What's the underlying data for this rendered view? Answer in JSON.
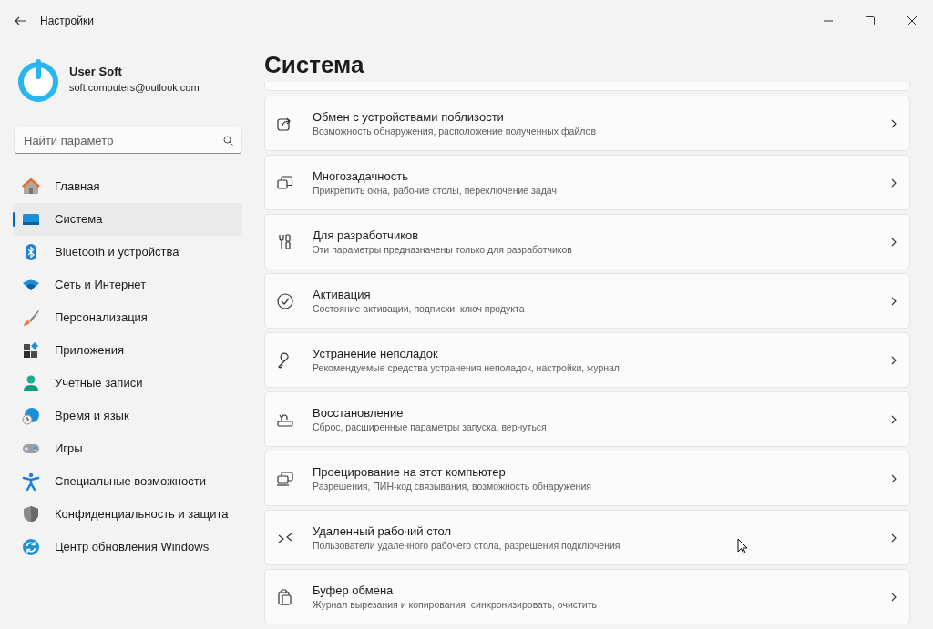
{
  "window": {
    "title": "Настройки"
  },
  "account": {
    "name": "User Soft",
    "email": "soft.computers@outlook.com"
  },
  "search": {
    "placeholder": "Найти параметр"
  },
  "sidebar": {
    "items": [
      {
        "label": "Главная",
        "selected": false
      },
      {
        "label": "Система",
        "selected": true
      },
      {
        "label": "Bluetooth и устройства",
        "selected": false
      },
      {
        "label": "Сеть и Интернет",
        "selected": false
      },
      {
        "label": "Персонализация",
        "selected": false
      },
      {
        "label": "Приложения",
        "selected": false
      },
      {
        "label": "Учетные записи",
        "selected": false
      },
      {
        "label": "Время и язык",
        "selected": false
      },
      {
        "label": "Игры",
        "selected": false
      },
      {
        "label": "Специальные возможности",
        "selected": false
      },
      {
        "label": "Конфиденциальность и защита",
        "selected": false
      },
      {
        "label": "Центр обновления Windows",
        "selected": false
      }
    ]
  },
  "page": {
    "title": "Система",
    "settings": [
      {
        "title": "Обмен с устройствами поблизости",
        "description": "Возможность обнаружения, расположение полученных файлов"
      },
      {
        "title": "Многозадачность",
        "description": "Прикрепить окна, рабочие столы, переключение задач"
      },
      {
        "title": "Для разработчиков",
        "description": "Эти параметры предназначены только для разработчиков"
      },
      {
        "title": "Активация",
        "description": "Состояние активации, подписки, ключ продукта"
      },
      {
        "title": "Устранение неполадок",
        "description": "Рекомендуемые средства устранения неполадок, настройки, журнал"
      },
      {
        "title": "Восстановление",
        "description": "Сброс, расширенные параметры запуска, вернуться"
      },
      {
        "title": "Проецирование на этот компьютер",
        "description": "Разрешения, ПИН-код связывания, возможность обнаружения"
      },
      {
        "title": "Удаленный рабочий стол",
        "description": "Пользователи удаленного рабочего стола, разрешения подключения"
      },
      {
        "title": "Буфер обмена",
        "description": "Журнал вырезания и копирования, синхронизировать, очистить"
      }
    ]
  }
}
